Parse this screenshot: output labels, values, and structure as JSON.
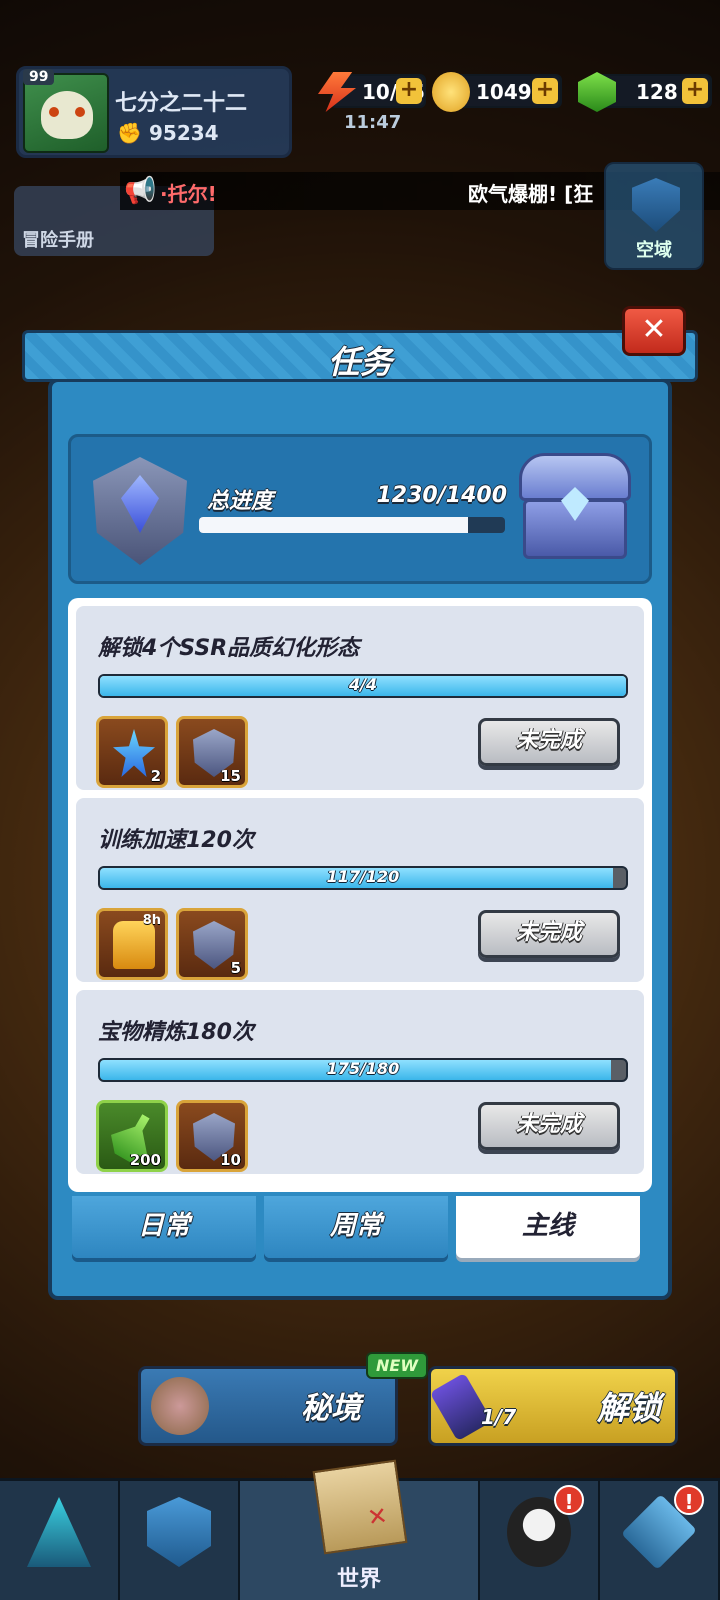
{
  "hud": {
    "level": "99",
    "player_name": "七分之二十二",
    "power": "95234",
    "energy": "10/45",
    "gold": "1049K",
    "gems": "128",
    "time": "11:47"
  },
  "ticker": {
    "segment_1": "·托尔!",
    "segment_2": "欧气爆棚! [狂"
  },
  "side": {
    "adventure_book": "冒险手册",
    "airspace": "空域"
  },
  "modal": {
    "title": "任务",
    "close_label": "✕",
    "total_label": "总进度",
    "total_value": "1230/1400",
    "total_progress": 0.879,
    "tasks": [
      {
        "name": "解锁4个SSR品质幻化形态",
        "progress_text": "4/4",
        "progress": 1.0,
        "rewards": [
          {
            "icon": "crystal-star-icon",
            "count": "2"
          },
          {
            "icon": "rank-gem-icon",
            "count": "15"
          }
        ],
        "button": "未完成"
      },
      {
        "name": "训练加速120次",
        "progress_text": "117/120",
        "progress": 0.975,
        "rewards": [
          {
            "icon": "gold-chest-icon",
            "count": "",
            "time": "8h"
          },
          {
            "icon": "rank-gem-icon",
            "count": "5"
          }
        ],
        "button": "未完成"
      },
      {
        "name": "宝物精炼180次",
        "progress_text": "175/180",
        "progress": 0.972,
        "rewards": [
          {
            "icon": "green-potion-icon",
            "count": "200"
          },
          {
            "icon": "rank-gem-icon",
            "count": "10"
          }
        ],
        "button": "未完成"
      }
    ],
    "tabs": [
      {
        "label": "日常",
        "active": false
      },
      {
        "label": "周常",
        "active": false
      },
      {
        "label": "主线",
        "active": true
      }
    ]
  },
  "bottom": {
    "secret_realm": "秘境",
    "new_badge": "NEW",
    "unlock": "解锁",
    "unlock_progress": "1/7"
  },
  "nav": {
    "world": "世界",
    "alert_mark": "!"
  }
}
